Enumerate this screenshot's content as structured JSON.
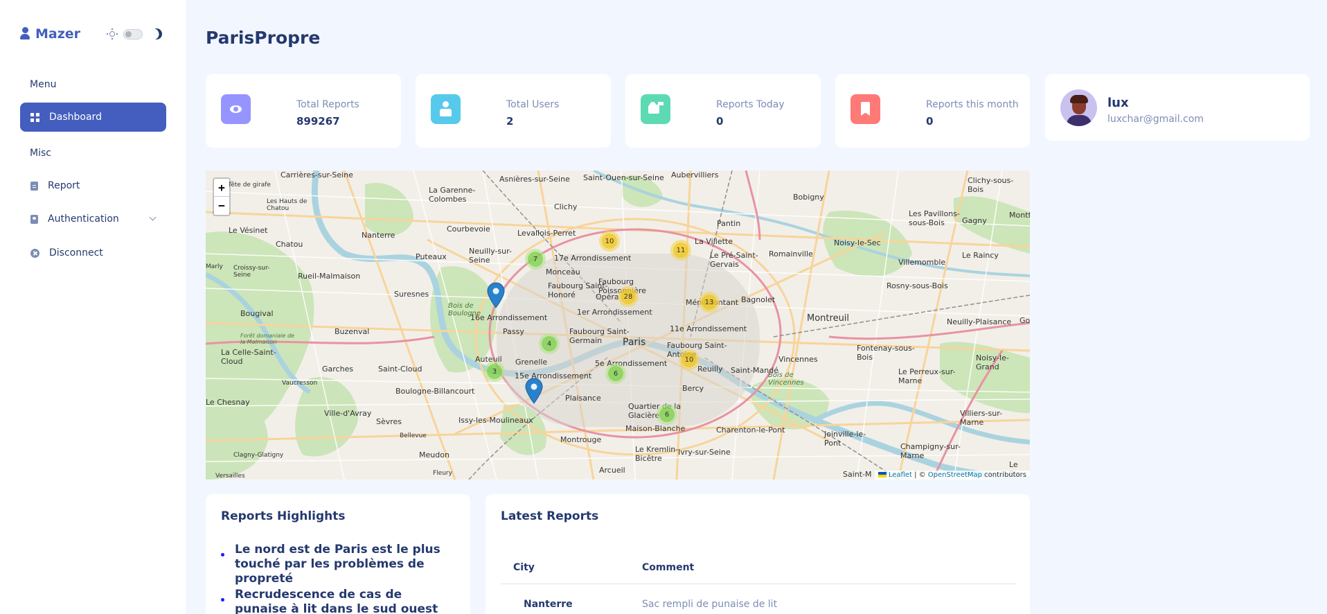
{
  "sidebar": {
    "brand": "Mazer",
    "sections": [
      {
        "title": "Menu"
      },
      {
        "title": "Misc"
      }
    ],
    "items": [
      {
        "label": "Dashboard"
      },
      {
        "label": "Report"
      },
      {
        "label": "Authentication"
      },
      {
        "label": "Disconnect"
      }
    ],
    "icons": [
      "grid-icon",
      "file-icon",
      "id-badge-icon",
      "x-circle-icon"
    ]
  },
  "header": {
    "title": "ParisPropre"
  },
  "stats": [
    {
      "label": "Total Reports",
      "value": "899267",
      "icon": "eye-icon",
      "color": "#9694ff"
    },
    {
      "label": "Total Users",
      "value": "2",
      "icon": "user-icon",
      "color": "#57caeb"
    },
    {
      "label": "Reports Today",
      "value": "0",
      "icon": "user-plus-icon",
      "color": "#5ddab4"
    },
    {
      "label": "Reports this month",
      "value": "0",
      "icon": "bookmark-icon",
      "color": "#ff7976"
    }
  ],
  "profile": {
    "name": "lux",
    "email": "luxchar@gmail.com"
  },
  "map": {
    "zoom_in": "+",
    "zoom_out": "−",
    "places": [
      "Asnières-sur-Seine",
      "Saint-Ouen-sur-Seine",
      "Aubervilliers",
      "Bobigny",
      "Clichy-sous-Bois",
      "Carrières-sur-Seine",
      "La Garenne-Colombes",
      "Clichy",
      "Pantin",
      "Les Pavillons-sous-Bois",
      "Courbevoie",
      "Levallois-Perret",
      "Nanterre",
      "Puteaux",
      "Neuilly-sur-Seine",
      "Chatou",
      "Le Vésinet",
      "Rueil-Malmaison",
      "Suresnes",
      "Le Pré-Saint-Gervais",
      "Romainville",
      "Noisy-le-Sec",
      "Villemomble",
      "Gagny",
      "Le Raincy",
      "Montreuil",
      "Bagnolet",
      "Rosny-sous-Bois",
      "Neuilly-Plaisance",
      "Paris",
      "Vincennes",
      "Fontenay-sous-Bois",
      "Saint-Mandé",
      "Boulogne-Billancourt",
      "Saint-Cloud",
      "Garches",
      "La Celle-Saint-Cloud",
      "Issy-les-Moulineaux",
      "Sèvres",
      "Ville-d'Avray",
      "Montrouge",
      "Charenton-le-Pont",
      "Ivry-sur-Seine",
      "Le Kremlin-Bicêtre",
      "Arcueil",
      "Meudon",
      "Le Chesnay",
      "Le Perreux-sur-Marne",
      "Joinville-le-Pont",
      "Champigny-sur-Marne",
      "Villiers-sur-Marne",
      "Noisy-le-Grand",
      "Bois de Boulogne",
      "Bois de Vincennes",
      "16e Arrondissement",
      "17e Arrondissement",
      "15e Arrondissement",
      "1er Arrondissement",
      "11e Arrondissement",
      "5e Arrondissement",
      "Opéra",
      "Passy",
      "Auteuil",
      "Grenelle",
      "Bercy",
      "Plaisance",
      "Monceau",
      "Faubourg Saint-Honoré",
      "Faubourg Saint-Germain",
      "Faubourg Poissonnière",
      "Ménilmontant",
      "La Villette",
      "Quartier de la Glacière",
      "Maison-Blanche",
      "Reuilly",
      "Faubourg Saint-Antoine",
      "Bougival",
      "Croissy-sur-Seine",
      "Buzenval",
      "Clagny-Glatigny",
      "Bellevue",
      "Fleury",
      "Vaucresson",
      "Marly",
      "Montfe",
      "Go",
      "Le Ple",
      "Saint-M",
      "Versailles",
      "Les Hauts de Chatou",
      "Tête de girafe",
      "Forêt domaniale de la Malmaison"
    ],
    "clusters": [
      {
        "count": "10",
        "level": "medium"
      },
      {
        "count": "11",
        "level": "medium"
      },
      {
        "count": "7",
        "level": "small"
      },
      {
        "count": "28",
        "level": "medium"
      },
      {
        "count": "13",
        "level": "medium"
      },
      {
        "count": "4",
        "level": "small"
      },
      {
        "count": "3",
        "level": "small"
      },
      {
        "count": "6",
        "level": "small"
      },
      {
        "count": "10",
        "level": "medium"
      },
      {
        "count": "6",
        "level": "small"
      }
    ],
    "attribution": {
      "leaflet": "Leaflet",
      "sep": " | © ",
      "osm": "OpenStreetMap",
      "suffix": " contributors"
    }
  },
  "highlights": {
    "title": "Reports Highlights",
    "items": [
      "Le nord est de Paris est le plus touché par les problèmes de propreté",
      "Recrudescence de cas de punaise à lit dans le sud ouest de Paris"
    ]
  },
  "latest": {
    "title": "Latest Reports",
    "columns": [
      "City",
      "Comment"
    ],
    "rows": [
      {
        "city": "Nanterre",
        "comment": "Sac rempli de punaise de lit"
      }
    ]
  }
}
